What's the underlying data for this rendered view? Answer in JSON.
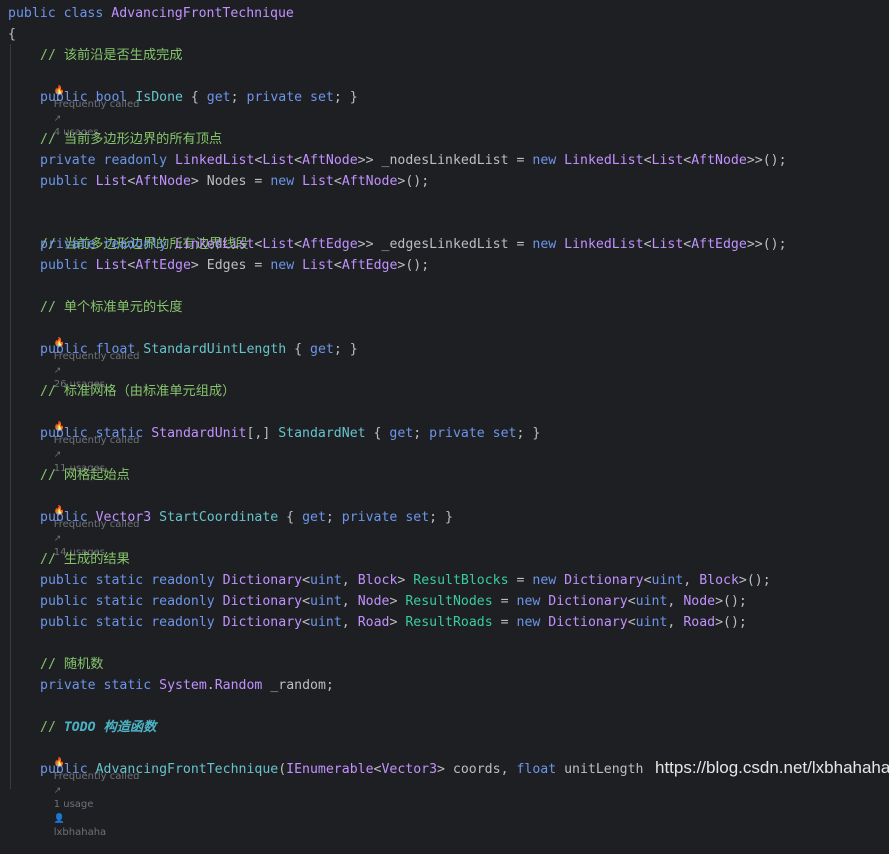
{
  "hints": {
    "frequently_called": "Frequently called",
    "usages_4": "4 usages",
    "usages_26": "26 usages",
    "usages_11": "11 usages",
    "usages_14": "14 usages",
    "usage_1": "1 usage",
    "author": "lxbhahaha"
  },
  "comments": {
    "is_done": "// 该前沿是否生成完成",
    "all_vertices": "// 当前多边形边界的所有顶点",
    "all_edges": "// 当前多边形边界的所有边界线段",
    "unit_length": "// 单个标准单元的长度",
    "net": "// 标准网格（由标准单元组成）",
    "start": "// 网格起始点",
    "results": "// 生成的结果",
    "random": "// 随机数",
    "todo_prefix": "// ",
    "todo_keyword": "TODO",
    "todo_text": " 构造函数"
  },
  "watermark": "https://blog.csdn.net/lxbhahaha",
  "icons": [
    "flame-icon",
    "usages-arrow-icon",
    "person-icon"
  ]
}
